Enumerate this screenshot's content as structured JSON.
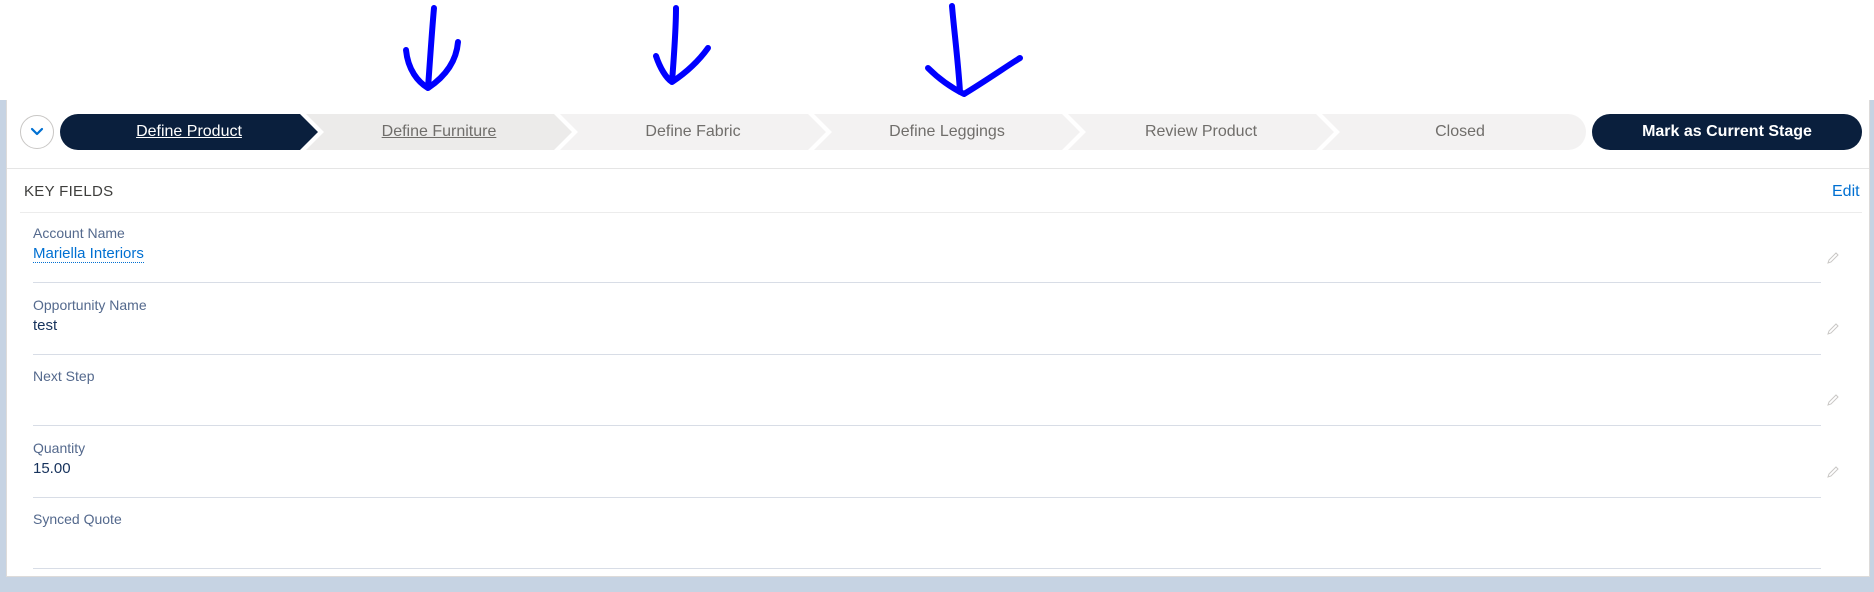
{
  "path": {
    "stages": [
      {
        "label": "Define Product",
        "state": "current"
      },
      {
        "label": "Define Furniture",
        "state": "hover"
      },
      {
        "label": "Define Fabric",
        "state": "incomplete"
      },
      {
        "label": "Define Leggings",
        "state": "incomplete"
      },
      {
        "label": "Review Product",
        "state": "incomplete"
      },
      {
        "label": "Closed",
        "state": "incomplete"
      }
    ],
    "mark_button": "Mark as Current Stage",
    "toggle_icon": "chevron-down-icon"
  },
  "key_fields": {
    "title": "KEY FIELDS",
    "edit_label": "Edit",
    "fields": [
      {
        "label": "Account Name",
        "value": "Mariella Interiors"
      },
      {
        "label": "Opportunity Name",
        "value": "test"
      },
      {
        "label": "Next Step",
        "value": ""
      },
      {
        "label": "Quantity",
        "value": "15.00"
      },
      {
        "label": "Synced Quote",
        "value": ""
      }
    ]
  },
  "colors": {
    "current_stage": "#0a1f3d",
    "hover_stage": "#ecebea",
    "incomplete_stage": "#f3f2f2",
    "link": "#0070d2",
    "annotation": "#0000ff"
  },
  "annotations": {
    "arrow_count": 3,
    "icon": "hand-drawn-arrow-icon"
  }
}
